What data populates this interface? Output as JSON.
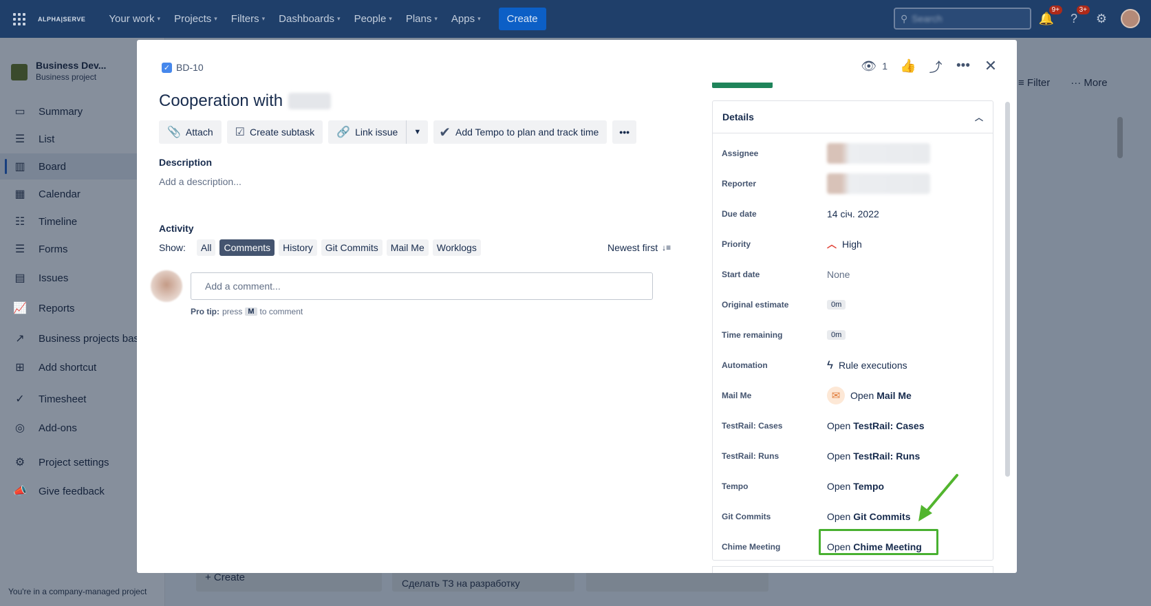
{
  "topnav": {
    "logo": "ALPHA|SERVE",
    "items": [
      "Your work",
      "Projects",
      "Filters",
      "Dashboards",
      "People",
      "Plans",
      "Apps"
    ],
    "create": "Create",
    "search_placeholder": "Search",
    "notif_badge": "9+",
    "help_badge": "3+"
  },
  "sidebar": {
    "project_name": "Business Dev...",
    "project_type": "Business project",
    "items": [
      {
        "label": "Summary",
        "icon": "summary-icon"
      },
      {
        "label": "List",
        "icon": "list-icon"
      },
      {
        "label": "Board",
        "icon": "board-icon"
      },
      {
        "label": "Calendar",
        "icon": "calendar-icon"
      },
      {
        "label": "Timeline",
        "icon": "timeline-icon"
      },
      {
        "label": "Forms",
        "icon": "forms-icon"
      },
      {
        "label": "Issues",
        "icon": "issues-icon"
      },
      {
        "label": "Reports",
        "icon": "reports-icon"
      },
      {
        "label": "Business projects bas",
        "icon": "external-link-icon"
      },
      {
        "label": "Add shortcut",
        "icon": "add-shortcut-icon"
      },
      {
        "label": "Timesheet",
        "icon": "timesheet-icon"
      },
      {
        "label": "Add-ons",
        "icon": "addons-icon"
      },
      {
        "label": "Project settings",
        "icon": "gear-icon"
      },
      {
        "label": "Give feedback",
        "icon": "megaphone-icon"
      }
    ],
    "footer": "You're in a company-managed project"
  },
  "board": {
    "filter": "Filter",
    "more": "More",
    "create": "+ Create",
    "card_text": "Сделать ТЗ на разработку"
  },
  "modal": {
    "issue_key": "BD-10",
    "title": "Cooperation with",
    "watch_count": "1",
    "toolbar": {
      "attach": "Attach",
      "create_subtask": "Create subtask",
      "link_issue": "Link issue",
      "tempo": "Add Tempo to plan and track time",
      "more": "•••"
    },
    "description_heading": "Description",
    "description_placeholder": "Add a description...",
    "activity_heading": "Activity",
    "show_label": "Show:",
    "filters": [
      "All",
      "Comments",
      "History",
      "Git Commits",
      "Mail Me",
      "Worklogs"
    ],
    "active_filter": "Comments",
    "sort": "Newest first",
    "comment_placeholder": "Add a comment...",
    "protip": {
      "bold": "Pro tip:",
      "press": "press",
      "key": "M",
      "rest": "to comment"
    }
  },
  "details": {
    "heading": "Details",
    "rows": [
      {
        "key": "Assignee"
      },
      {
        "key": "Reporter"
      },
      {
        "key": "Due date",
        "value": "14 січ. 2022"
      },
      {
        "key": "Priority",
        "value": "High"
      },
      {
        "key": "Start date",
        "value": "None"
      },
      {
        "key": "Original estimate",
        "value": "0m"
      },
      {
        "key": "Time remaining",
        "value": "0m"
      },
      {
        "key": "Automation",
        "value": "Rule executions"
      },
      {
        "key": "Mail Me",
        "prefix": "Open",
        "bold": "Mail Me"
      },
      {
        "key": "TestRail: Cases",
        "prefix": "Open",
        "bold": "TestRail: Cases"
      },
      {
        "key": "TestRail: Runs",
        "prefix": "Open",
        "bold": "TestRail: Runs"
      },
      {
        "key": "Tempo",
        "prefix": "Open",
        "bold": "Tempo"
      },
      {
        "key": "Git Commits",
        "prefix": "Open",
        "bold": "Git Commits"
      },
      {
        "key": "Chime Meeting",
        "prefix": "Open",
        "bold": "Chime Meeting"
      }
    ]
  },
  "colors": {
    "highlight": "#48b030",
    "nav_bg": "#1f3f6a",
    "active_filter": "#44546f"
  }
}
